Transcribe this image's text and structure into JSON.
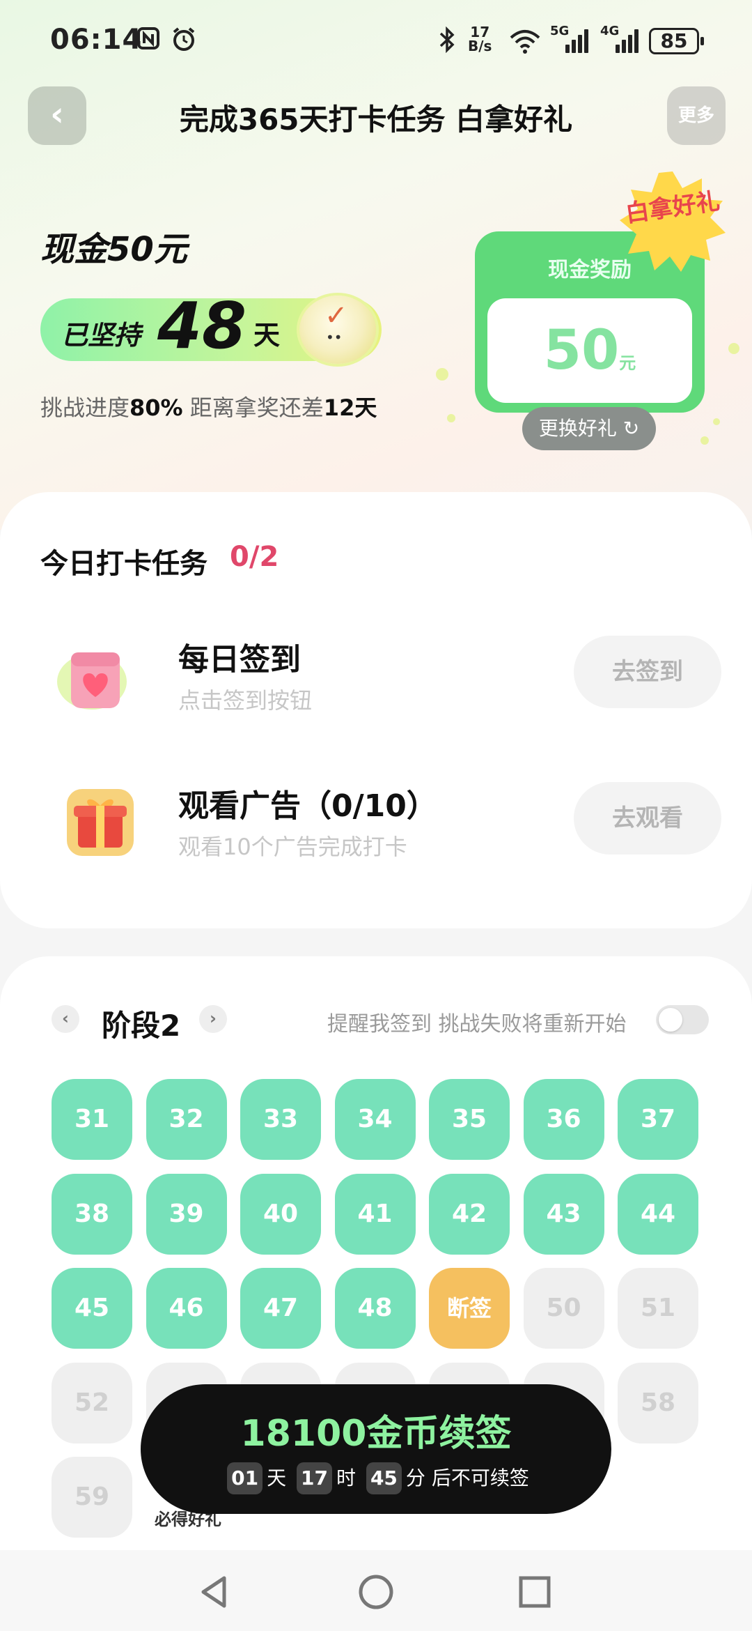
{
  "status_bar": {
    "time": "06:14",
    "net_speed_value": "17",
    "net_speed_unit": "B/s",
    "sig1_label": "5G",
    "sig2_label": "4G",
    "battery": "85"
  },
  "header": {
    "back_glyph": "‹",
    "title": "完成365天打卡任务 白拿好礼",
    "more_label": "更多"
  },
  "hero": {
    "reward_title": "现金50元",
    "streak_prefix": "已坚持",
    "streak_days": "48",
    "streak_unit": "天",
    "progress_label_a": "挑战进度",
    "progress_percent": "80%",
    "progress_label_b": " 距离拿奖还差",
    "progress_days_left": "12天",
    "card_label": "现金奖励",
    "card_value": "50",
    "card_unit": "元",
    "burst_text": "白拿好礼",
    "swap_label": "更换好礼 ↻"
  },
  "tasks": {
    "heading": "今日打卡任务",
    "count": "0/2",
    "items": [
      {
        "title": "每日签到",
        "subtitle": "点击签到按钮",
        "button": "去签到"
      },
      {
        "title": "观看广告（0/10）",
        "subtitle": "观看10个广告完成打卡",
        "button": "去观看"
      }
    ]
  },
  "stage": {
    "label": "阶段2",
    "remind_text": "提醒我签到 挑战失败将重新开始",
    "toggle_on": false,
    "days": [
      {
        "label": "31",
        "state": "done"
      },
      {
        "label": "32",
        "state": "done"
      },
      {
        "label": "33",
        "state": "done"
      },
      {
        "label": "34",
        "state": "done"
      },
      {
        "label": "35",
        "state": "done"
      },
      {
        "label": "36",
        "state": "done"
      },
      {
        "label": "37",
        "state": "done"
      },
      {
        "label": "38",
        "state": "done"
      },
      {
        "label": "39",
        "state": "done"
      },
      {
        "label": "40",
        "state": "done"
      },
      {
        "label": "41",
        "state": "done"
      },
      {
        "label": "42",
        "state": "done"
      },
      {
        "label": "43",
        "state": "done"
      },
      {
        "label": "44",
        "state": "done"
      },
      {
        "label": "45",
        "state": "done"
      },
      {
        "label": "46",
        "state": "done"
      },
      {
        "label": "47",
        "state": "done"
      },
      {
        "label": "48",
        "state": "done"
      },
      {
        "label": "断签",
        "state": "broken"
      },
      {
        "label": "50",
        "state": "future"
      },
      {
        "label": "51",
        "state": "future"
      },
      {
        "label": "52",
        "state": "future"
      },
      {
        "label": "",
        "state": "future"
      },
      {
        "label": "",
        "state": "future"
      },
      {
        "label": "",
        "state": "future"
      },
      {
        "label": "",
        "state": "future"
      },
      {
        "label": "",
        "state": "future"
      },
      {
        "label": "58",
        "state": "future"
      },
      {
        "label": "59",
        "state": "future"
      }
    ],
    "gift_label": "必得好礼"
  },
  "renew": {
    "title": "18100金币续签",
    "days": "01",
    "days_unit": "天",
    "hours": "17",
    "hours_unit": "时",
    "minutes": "45",
    "minutes_unit": "分",
    "suffix": "后不可续签"
  },
  "colors": {
    "done": "#77e1ba",
    "broken": "#f5c05f",
    "future": "#efefef",
    "accent_red": "#e0476a",
    "cash_green": "#5fd97a"
  }
}
